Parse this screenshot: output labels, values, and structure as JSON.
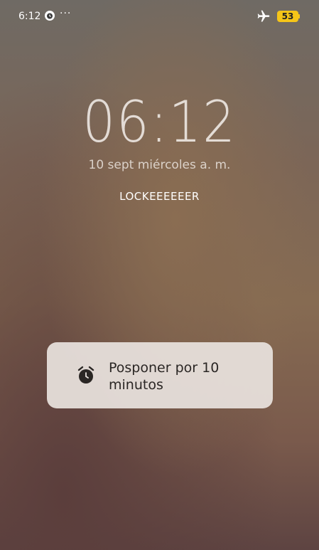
{
  "status_bar": {
    "time": "6:12",
    "notification_icon": "alarm-badge-icon",
    "more_indicator": "···",
    "airplane_icon": "airplane-icon",
    "battery_level": "53"
  },
  "lock_screen": {
    "time": "06:12",
    "date": "10 sept miércoles a. m.",
    "owner_message": "LOCKEEEEEER"
  },
  "alarm_action": {
    "icon": "alarm-clock-icon",
    "label": "Posponer por 10 minutos"
  },
  "colors": {
    "battery": "#f5c518",
    "card_background": "#e8e2de"
  }
}
